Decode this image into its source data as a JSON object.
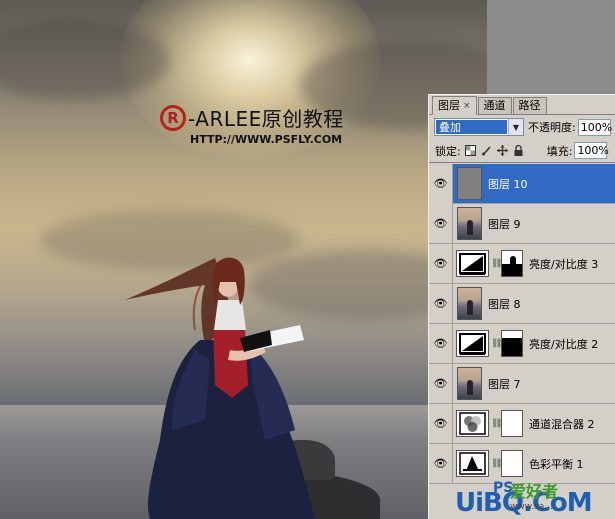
{
  "watermark": {
    "symbol": "R",
    "brand": "-ARLEE原创教程",
    "url": "HTTP://WWW.PSFLY.COM"
  },
  "panel": {
    "tabs": [
      {
        "label": "图层",
        "close": "×",
        "active": true
      },
      {
        "label": "通道",
        "active": false
      },
      {
        "label": "路径",
        "active": false
      }
    ],
    "blend_mode": "叠加",
    "opacity_label": "不透明度:",
    "opacity_value": "100%",
    "lock_label": "锁定:",
    "fill_label": "填充:",
    "fill_value": "100%",
    "layers": [
      {
        "name": "图层 10",
        "type": "fill-gray",
        "selected": true
      },
      {
        "name": "图层 9",
        "type": "photo"
      },
      {
        "name": "亮度/对比度 3",
        "type": "adjustment"
      },
      {
        "name": "图层 8",
        "type": "photo"
      },
      {
        "name": "亮度/对比度 2",
        "type": "adjustment"
      },
      {
        "name": "图层 7",
        "type": "photo"
      },
      {
        "name": "通道混合器 2",
        "type": "adjustment"
      },
      {
        "name": "色彩平衡 1",
        "type": "adjustment"
      }
    ]
  },
  "corner_logo": {
    "brand": "UiBQ.CoM",
    "prefix": "PS",
    "cn": "爱好者",
    "site": "www.sa..."
  }
}
